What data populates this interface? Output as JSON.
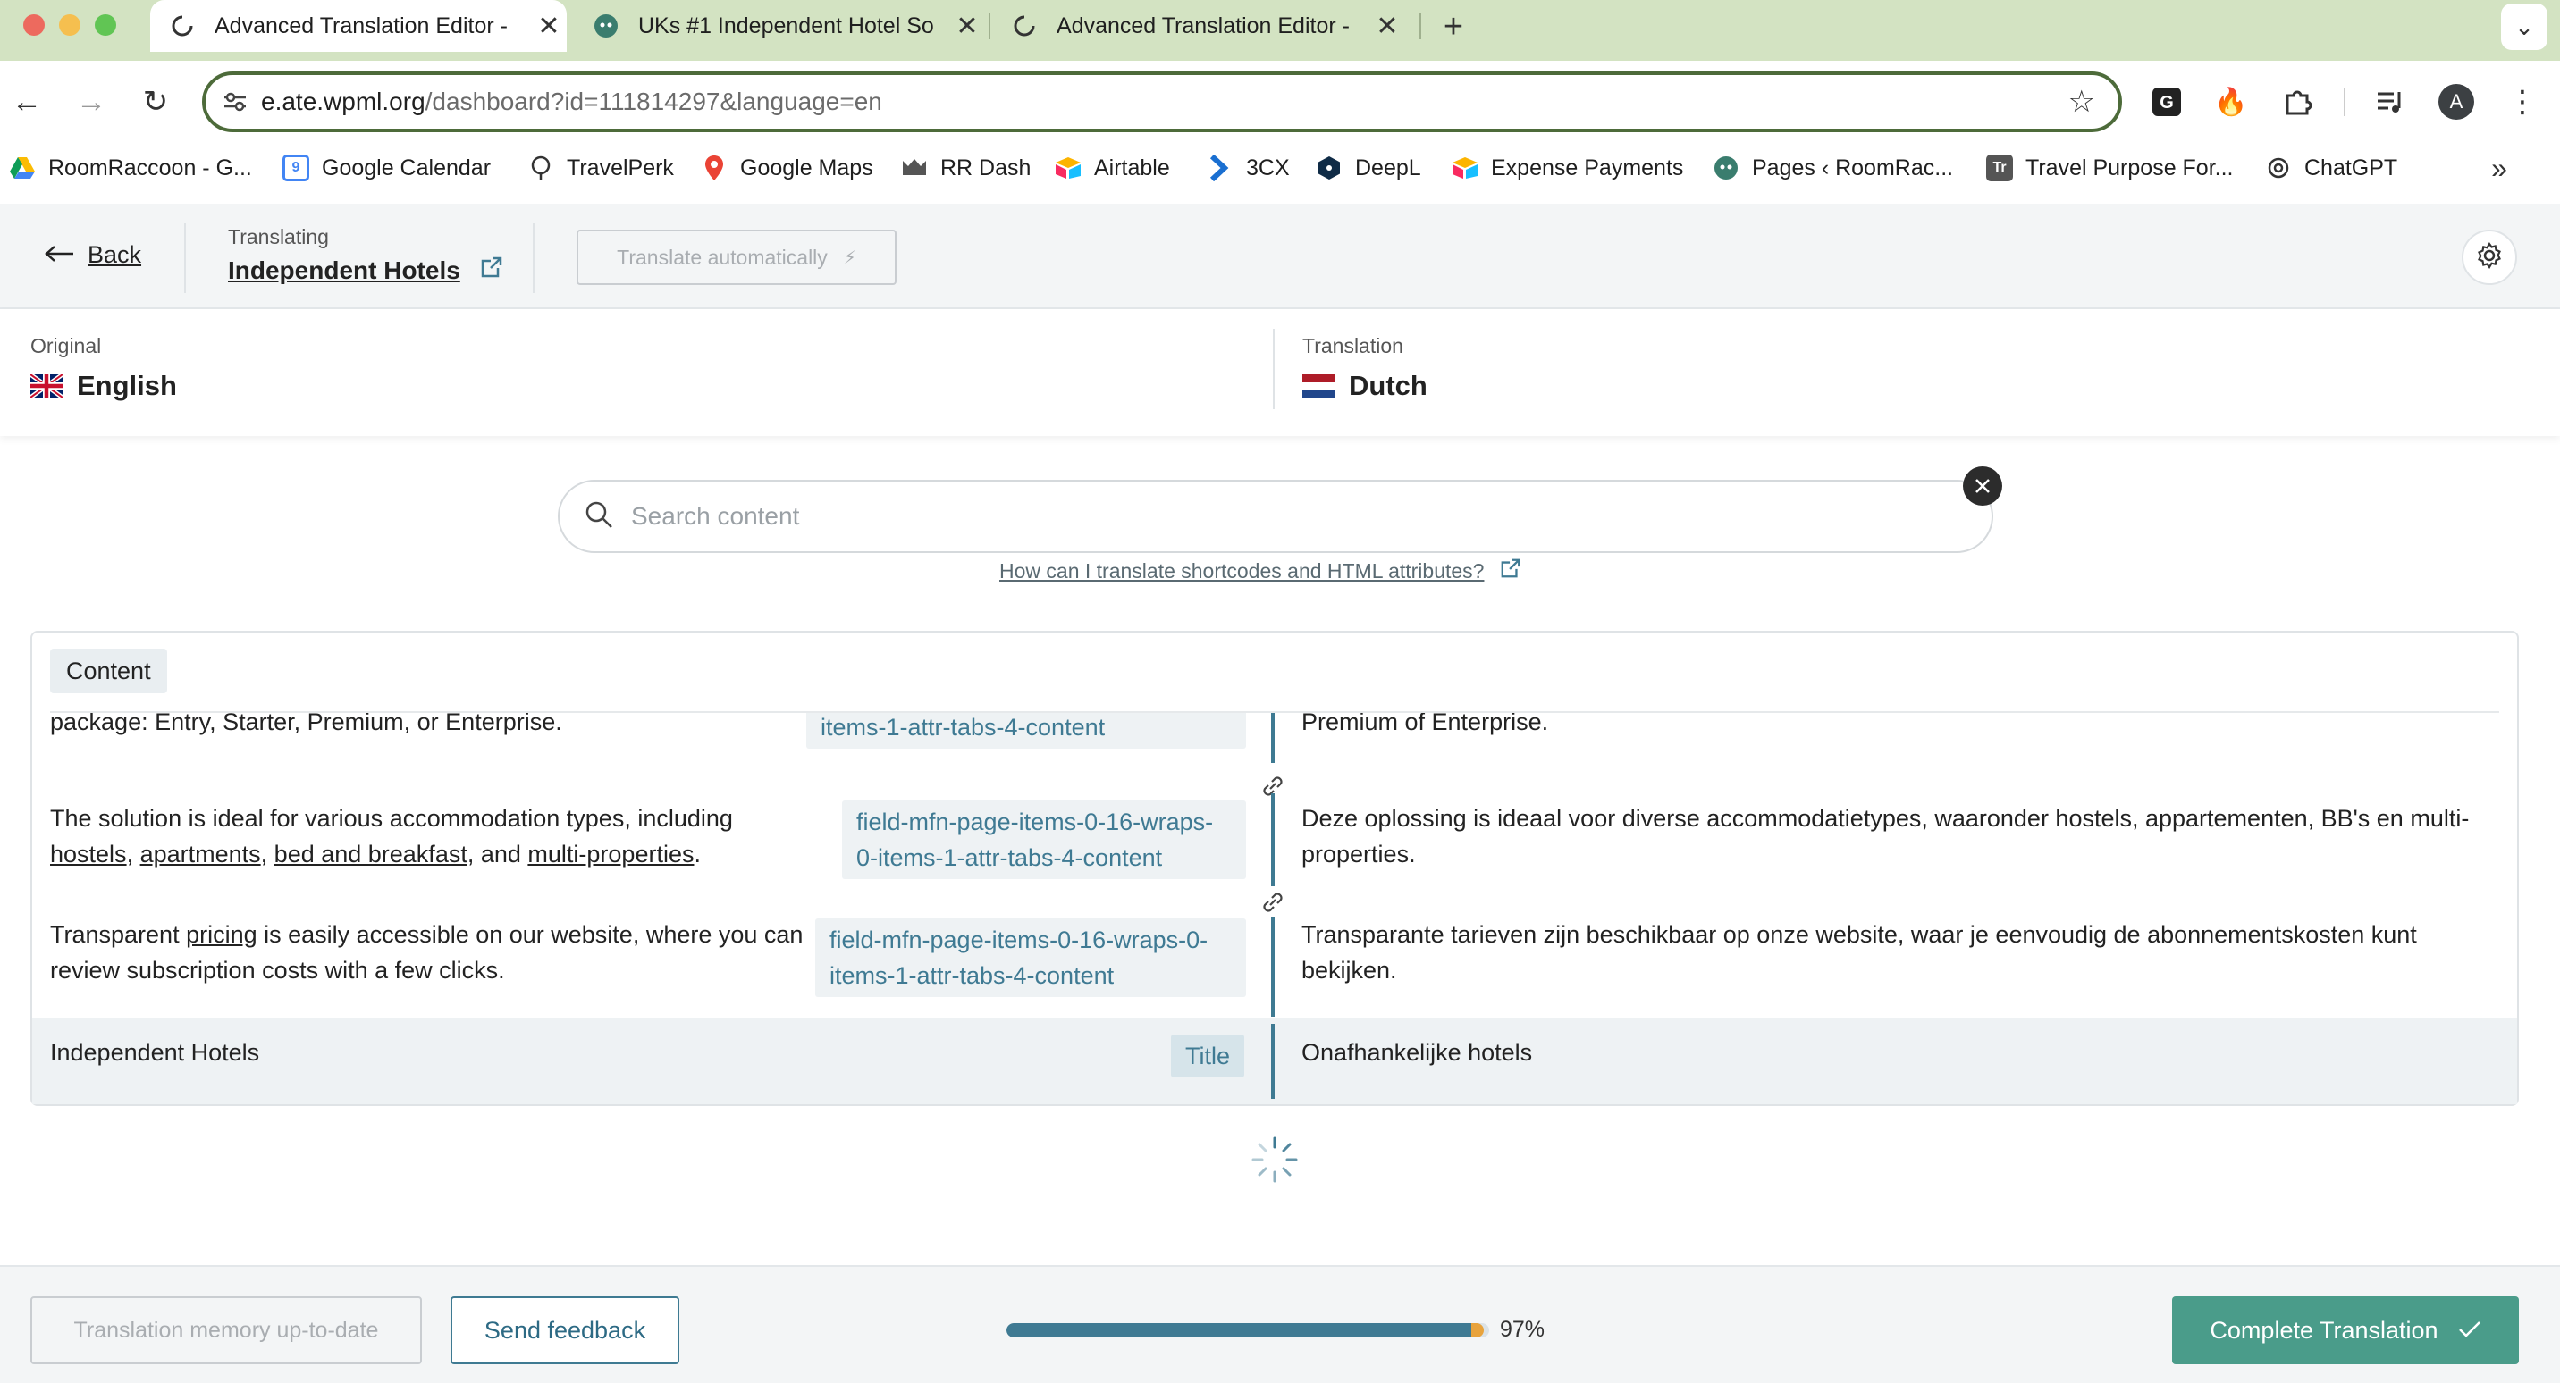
{
  "browser": {
    "tabs": [
      {
        "title": "Advanced Translation Editor -",
        "active": true
      },
      {
        "title": "UKs #1 Independent Hotel So",
        "active": false
      },
      {
        "title": "Advanced Translation Editor -",
        "active": false
      }
    ],
    "new_tab_icon": "plus-icon",
    "url_host": "e.ate.wpml.org",
    "url_path": "/dashboard?id=111814297&language=en",
    "profile_initial": "A",
    "bookmarks": [
      {
        "label": "RoomRaccoon - G...",
        "icon": "roomraccoon-icon"
      },
      {
        "label": "Google Calendar",
        "icon": "calendar-icon"
      },
      {
        "label": "TravelPerk",
        "icon": "travelperk-icon"
      },
      {
        "label": "Google Maps",
        "icon": "maps-icon"
      },
      {
        "label": "RR Dash",
        "icon": "rrdash-icon"
      },
      {
        "label": "Airtable",
        "icon": "airtable-icon"
      },
      {
        "label": "3CX",
        "icon": "3cx-icon"
      },
      {
        "label": "DeepL",
        "icon": "deepl-icon"
      },
      {
        "label": "Expense Payments",
        "icon": "expense-icon"
      },
      {
        "label": "Pages ‹ RoomRac...",
        "icon": "pages-icon"
      },
      {
        "label": "Travel Purpose For...",
        "icon": "tr-icon"
      },
      {
        "label": "ChatGPT",
        "icon": "chatgpt-icon"
      }
    ],
    "calendar_day": "9",
    "tr_letters": "Tr"
  },
  "header": {
    "back_label": "Back",
    "translating_label": "Translating",
    "document_title": "Independent Hotels",
    "translate_auto_label": "Translate automatically"
  },
  "languages": {
    "original_label": "Original",
    "original_name": "English",
    "translation_label": "Translation",
    "translation_name": "Dutch"
  },
  "search": {
    "placeholder": "Search content",
    "help_link": "How can I translate shortcodes and HTML attributes?"
  },
  "content": {
    "section_label": "Content",
    "rows": [
      {
        "source": "package: Entry, Starter, Premium, or Enterprise.",
        "tag": "items-1-attr-tabs-4-content",
        "target": "Premium of Enterprise."
      },
      {
        "source_parts": [
          "The solution is ideal for various accommodation types, including ",
          "hostels",
          ", ",
          "apartments",
          ", ",
          "bed and breakfast",
          ", and ",
          "multi-properties",
          "."
        ],
        "tag_line1": "field-mfn-page-items-0-16-wraps-",
        "tag_line2": "0-items-1-attr-tabs-4-content",
        "target": "Deze oplossing is ideaal voor diverse accommodatietypes, waaronder hostels, appartementen, BB's en multi-properties."
      },
      {
        "source_parts": [
          "Transparent ",
          "pricing",
          " is easily accessible on our website, where you can review subscription costs with a few clicks."
        ],
        "tag_line1": "field-mfn-page-items-0-16-wraps-0-",
        "tag_line2": "items-1-attr-tabs-4-content",
        "target": "Transparante tarieven zijn beschikbaar op onze website, waar je eenvoudig de abonnementskosten kunt bekijken."
      },
      {
        "source": "Independent Hotels",
        "tag": "Title",
        "target": "Onafhankelijke hotels"
      }
    ]
  },
  "footer": {
    "tm_label": "Translation memory up-to-date",
    "feedback_label": "Send feedback",
    "progress_percent": 97,
    "progress_label": "97%",
    "complete_label": "Complete Translation"
  },
  "colors": {
    "accent": "#3f7a93",
    "complete": "#4a9c8a",
    "progress_tip": "#e8a33c",
    "tab_bar": "#d3e3c2"
  }
}
